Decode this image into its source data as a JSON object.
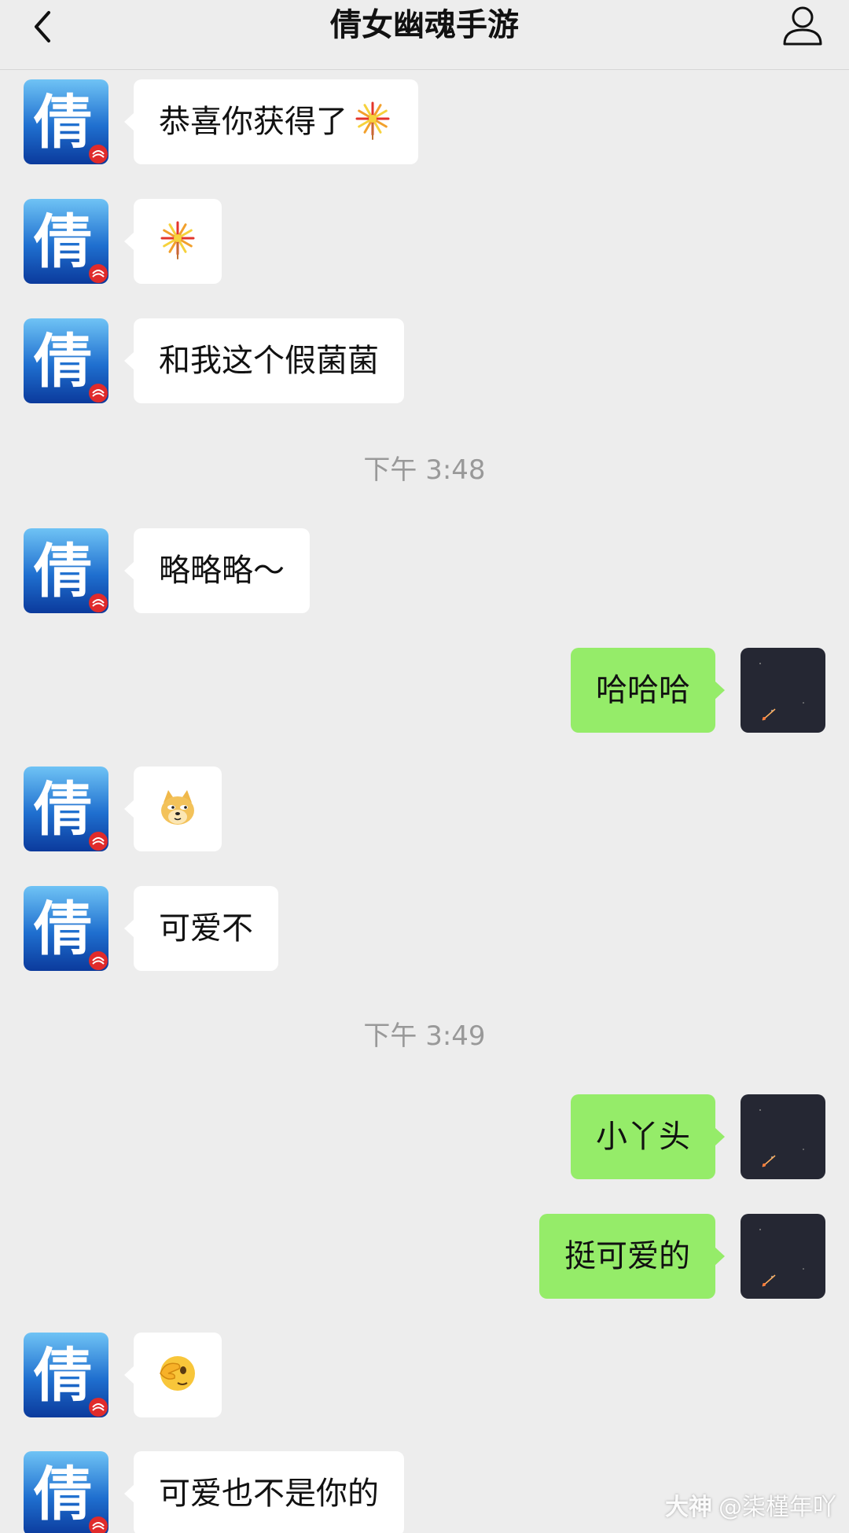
{
  "header": {
    "title": "倩女幽魂手游",
    "back_icon": "chevron-left-icon",
    "profile_icon": "person-icon"
  },
  "colors": {
    "background": "#ededed",
    "incoming_bubble": "#ffffff",
    "outgoing_bubble": "#95ec69",
    "timestamp_text": "#999999"
  },
  "messages": [
    {
      "sender": "qiannv",
      "text": "恭喜你获得了",
      "emoji": "fireworks-emoji"
    },
    {
      "sender": "qiannv",
      "text": "",
      "emoji": "fireworks-emoji"
    },
    {
      "sender": "qiannv",
      "text": "和我这个假菌菌"
    },
    {
      "timestamp": "下午 3:48"
    },
    {
      "sender": "qiannv",
      "text": "略略略～"
    },
    {
      "sender": "me",
      "text": "哈哈哈"
    },
    {
      "sender": "qiannv",
      "text": "",
      "emoji": "doge-emoji"
    },
    {
      "sender": "qiannv",
      "text": "可爱不"
    },
    {
      "timestamp": "下午 3:49"
    },
    {
      "sender": "me",
      "text": "小丫头"
    },
    {
      "sender": "me",
      "text": "挺可爱的"
    },
    {
      "sender": "qiannv",
      "text": "",
      "emoji": "face-palm-emoji"
    },
    {
      "sender": "qiannv",
      "text": "可爱也不是你的"
    }
  ],
  "avatars": {
    "qiannv": {
      "glyph": "倩",
      "icon": "qiannv-logo-avatar"
    },
    "me": {
      "icon": "moon-night-avatar"
    }
  },
  "watermark": {
    "brand": "大神",
    "handle": "@柒槿年吖"
  }
}
